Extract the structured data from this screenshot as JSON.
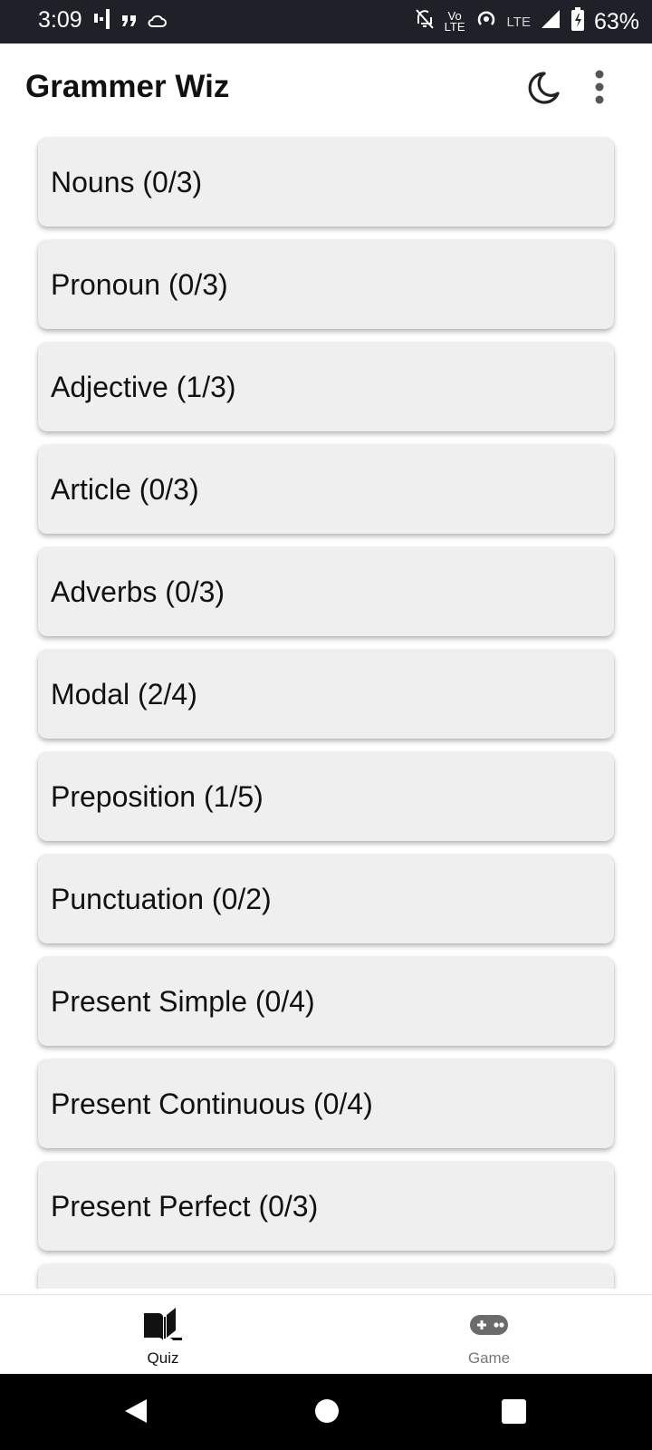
{
  "status_bar": {
    "time": "3:09",
    "battery": "63%",
    "volte_label_top": "Vo",
    "volte_label_bottom": "LTE",
    "network": "LTE",
    "icons": [
      "network-activity-icon",
      "quote-icon",
      "cloud-icon",
      "bell-off-icon",
      "volte-icon",
      "hotspot-icon",
      "signal-icon",
      "battery-charging-icon"
    ]
  },
  "app_bar": {
    "title": "Grammer Wiz",
    "actions": [
      "dark-mode-icon",
      "more-options-icon"
    ]
  },
  "topics": [
    {
      "label": "Nouns (0/3)"
    },
    {
      "label": "Pronoun (0/3)"
    },
    {
      "label": "Adjective (1/3)"
    },
    {
      "label": "Article (0/3)"
    },
    {
      "label": "Adverbs (0/3)"
    },
    {
      "label": "Modal (2/4)"
    },
    {
      "label": "Preposition (1/5)"
    },
    {
      "label": "Punctuation (0/2)"
    },
    {
      "label": "Present Simple (0/4)"
    },
    {
      "label": "Present Continuous (0/4)"
    },
    {
      "label": "Present Perfect (0/3)"
    },
    {
      "label": ""
    }
  ],
  "bottom_nav": {
    "items": [
      {
        "label": "Quiz",
        "icon": "book-icon",
        "selected": true
      },
      {
        "label": "Game",
        "icon": "gamepad-icon",
        "selected": false
      }
    ]
  },
  "colors": {
    "status_bar_bg": "#1f2129",
    "card_bg": "#efefef",
    "selected_nav": "#111111",
    "unselected_nav": "#777777"
  }
}
